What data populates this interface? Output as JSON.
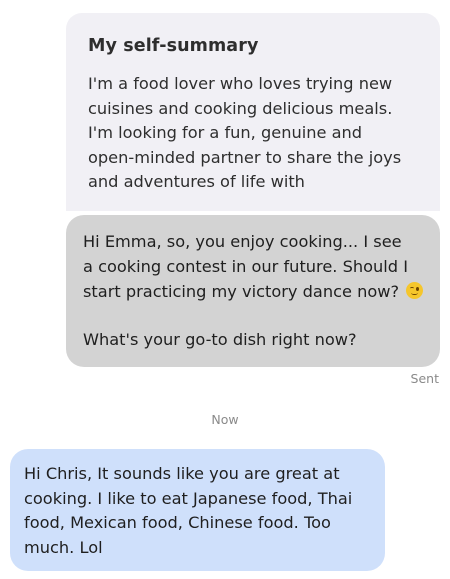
{
  "profile_quote": {
    "title": "My self-summary",
    "lines": [
      "I'm a food lover who loves trying new",
      "cuisines and cooking delicious meals.",
      "I'm looking for a fun, genuine and",
      "open-minded partner to share the joys",
      "and adventures of life with"
    ]
  },
  "sent_message": {
    "lines": [
      "Hi Emma, so, you enjoy cooking... I see",
      "a cooking contest in our future. Should I",
      "start practicing my victory dance now?"
    ],
    "emoji": "winking-face-emoji",
    "question": "What's your go-to dish right now?",
    "status": "Sent"
  },
  "timestamp": "Now",
  "received_message": {
    "lines": [
      "Hi Chris, It sounds like you are great at",
      "cooking. I like to eat Japanese food, Thai",
      "food, Mexican food, Chinese food. Too",
      "much. Lol"
    ]
  },
  "colors": {
    "quote_bg": "#f1f0f5",
    "sent_bubble_bg": "#d3d3d3",
    "received_bubble_bg": "#cfe0fb",
    "meta_text": "#8a8a8a"
  }
}
